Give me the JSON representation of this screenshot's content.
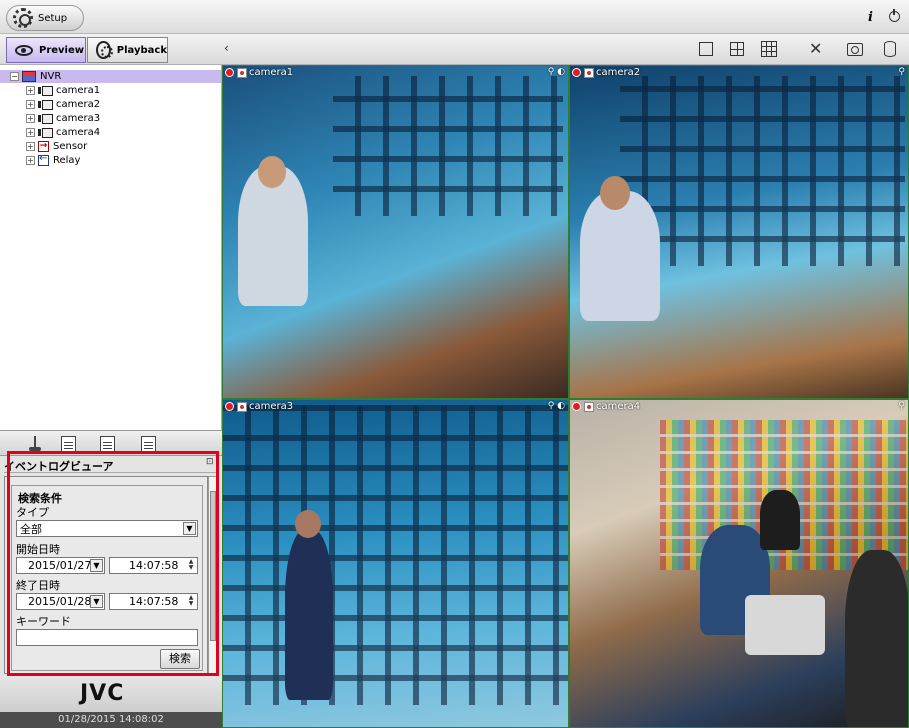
{
  "topbar": {
    "setup_label": "Setup"
  },
  "tabs": {
    "preview_label": "Preview",
    "playback_label": "Playback"
  },
  "tree": {
    "root": "NVR",
    "cameras": [
      "camera1",
      "camera2",
      "camera3",
      "camera4"
    ],
    "sensor": "Sensor",
    "relay": "Relay"
  },
  "event_viewer": {
    "title": "イベントログビューア",
    "search_conditions": "検索条件",
    "type_label": "タイプ",
    "type_value": "全部",
    "start_label": "開始日時",
    "start_date": "2015/01/27",
    "start_time": "14:07:58",
    "end_label": "終了日時",
    "end_date": "2015/01/28",
    "end_time": "14:07:58",
    "keyword_label": "キーワード",
    "keyword_value": "",
    "search_button": "検索"
  },
  "brand": {
    "logo": "JVC",
    "datetime": "01/28/2015 14:08:02"
  },
  "videos": [
    {
      "label": "camera1"
    },
    {
      "label": "camera2"
    },
    {
      "label": "camera3"
    },
    {
      "label": "camera4"
    }
  ],
  "colors": {
    "highlight": "#e3001b",
    "selected_row": "#c8b9ef",
    "rec": "#e51b1b"
  },
  "icons": [
    "setup-gear-icon",
    "info-icon",
    "power-icon",
    "eye-icon",
    "film-reel-icon",
    "single-view-icon",
    "quad-view-icon",
    "grid-view-icon",
    "fullscreen-icon",
    "snapshot-icon",
    "storage-icon"
  ]
}
